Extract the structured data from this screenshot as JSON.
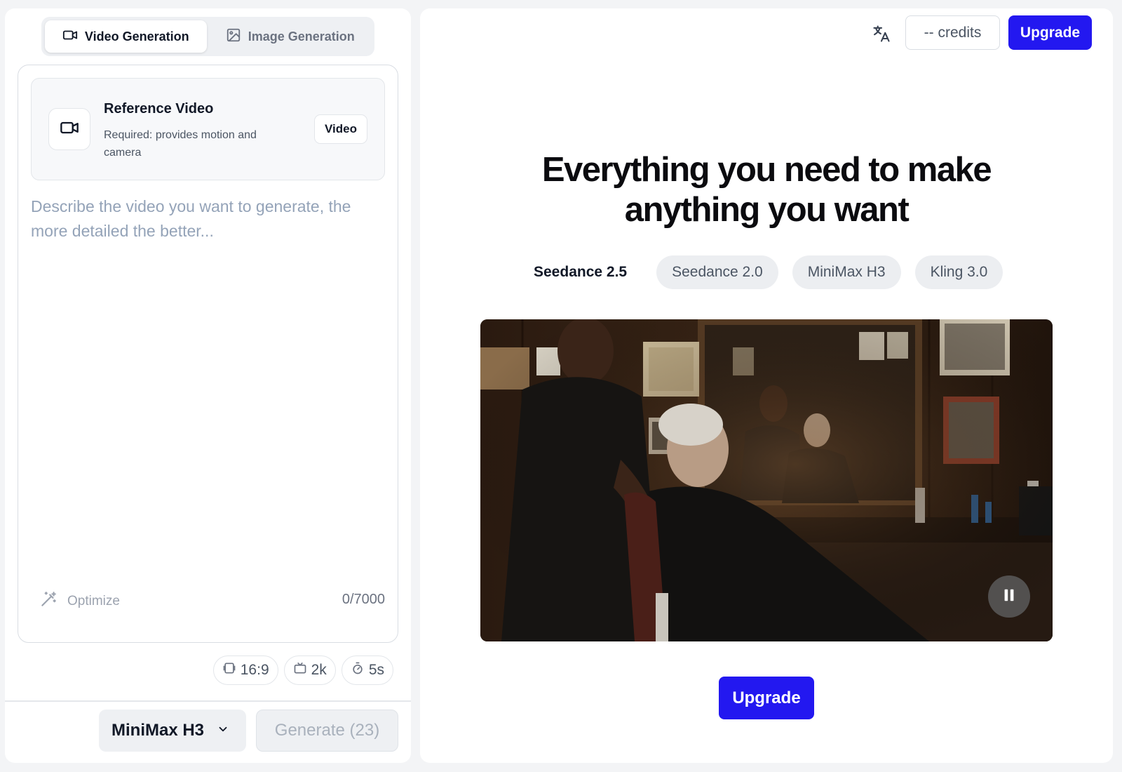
{
  "left_panel": {
    "mode_tabs": [
      {
        "label": "Video Generation",
        "icon": "video-camera-icon",
        "active": true
      },
      {
        "label": "Image Generation",
        "icon": "image-icon",
        "active": false
      }
    ],
    "reference": {
      "title": "Reference Video",
      "description": "Required: provides motion and camera",
      "button_label": "Video",
      "icon": "video-camera-icon"
    },
    "prompt": {
      "placeholder": "Describe the video you want to generate, the more detailed the better...",
      "value": ""
    },
    "optimize_label": "Optimize",
    "char_count": "0/7000",
    "settings": {
      "aspect_ratio": "16:9",
      "resolution": "2k",
      "duration": "5s"
    },
    "model_select": {
      "value": "MiniMax H3"
    },
    "generate_label": "Generate (23)"
  },
  "right_panel": {
    "header": {
      "translate_icon": "translate-icon",
      "credits_label": "-- credits",
      "upgrade_label": "Upgrade"
    },
    "headline_line1": "Everything you need to make",
    "headline_line2": "anything you want",
    "model_tabs": [
      {
        "label": "Seedance 2.5",
        "active": true
      },
      {
        "label": "Seedance 2.0",
        "active": false
      },
      {
        "label": "MiniMax H3",
        "active": false
      },
      {
        "label": "Kling 3.0",
        "active": false
      }
    ],
    "video": {
      "state": "playing",
      "control_icon": "pause-icon"
    },
    "upgrade_cta": "Upgrade"
  },
  "colors": {
    "accent": "#2318f0",
    "panel_bg": "#ffffff",
    "page_bg": "#f3f4f6",
    "muted_text": "#6b7280",
    "placeholder": "#94a3b8"
  }
}
